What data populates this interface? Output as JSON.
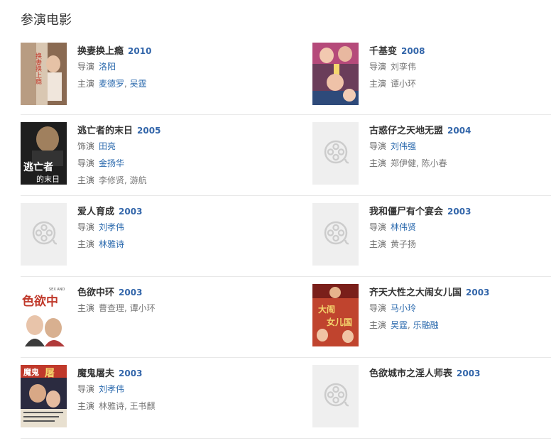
{
  "section_title": "参演电影",
  "colors": {
    "link": "#2a69ad",
    "year": "#3366aa",
    "divider": "#e8e8e8",
    "placeholder": "#efefef"
  },
  "movies": [
    {
      "title": "换妻换上瘾",
      "year": "2010",
      "poster": "poster-1",
      "lines": [
        {
          "label": "导演",
          "people": [
            {
              "name": "洛阳",
              "link": true
            }
          ],
          "text": ""
        },
        {
          "label": "主演",
          "people": [
            {
              "name": "麦德罗",
              "link": true
            },
            {
              "name": "吴霆",
              "link": true
            }
          ],
          "text": ""
        }
      ]
    },
    {
      "title": "千基变",
      "year": "2008",
      "poster": "poster-2",
      "lines": [
        {
          "label": "导演",
          "text": "刘孪伟"
        },
        {
          "label": "主演",
          "text": "谭小环"
        }
      ]
    },
    {
      "title": "逃亡者的末日",
      "year": "2005",
      "poster": "poster-3",
      "lines": [
        {
          "label": "饰演",
          "people": [
            {
              "name": "田亮",
              "link": true
            }
          ],
          "text": ""
        },
        {
          "label": "导演",
          "people": [
            {
              "name": "金扬华",
              "link": true
            }
          ],
          "text": ""
        },
        {
          "label": "主演",
          "text": "李修贤, 游航"
        }
      ]
    },
    {
      "title": "古惑仔之天地无盟",
      "year": "2004",
      "poster": "placeholder",
      "lines": [
        {
          "label": "导演",
          "people": [
            {
              "name": "刘伟强",
              "link": true
            }
          ],
          "text": ""
        },
        {
          "label": "主演",
          "text": "郑伊健, 陈小春"
        }
      ]
    },
    {
      "title": "爱人育成",
      "year": "2003",
      "poster": "placeholder",
      "lines": [
        {
          "label": "导演",
          "people": [
            {
              "name": "刘孝伟",
              "link": true
            }
          ],
          "text": ""
        },
        {
          "label": "主演",
          "people": [
            {
              "name": "林雅诗",
              "link": true
            }
          ],
          "text": ""
        }
      ]
    },
    {
      "title": "我和僵尸有个宴会",
      "year": "2003",
      "poster": "placeholder",
      "lines": [
        {
          "label": "导演",
          "people": [
            {
              "name": "林伟贤",
              "link": true
            }
          ],
          "text": ""
        },
        {
          "label": "主演",
          "text": "黄子扬"
        }
      ]
    },
    {
      "title": "色欲中环",
      "year": "2003",
      "poster": "poster-4",
      "lines": [
        {
          "label": "主演",
          "text": "曹查理, 谭小环"
        }
      ]
    },
    {
      "title": "齐天大性之大闹女儿国",
      "year": "2003",
      "poster": "poster-5",
      "lines": [
        {
          "label": "导演",
          "people": [
            {
              "name": "马小玲",
              "link": true
            }
          ],
          "text": ""
        },
        {
          "label": "主演",
          "people": [
            {
              "name": "吴霆",
              "link": true
            },
            {
              "name": "乐融融",
              "link": true
            }
          ],
          "text": ""
        }
      ]
    },
    {
      "title": "魔鬼屠夫",
      "year": "2003",
      "poster": "poster-6",
      "lines": [
        {
          "label": "导演",
          "people": [
            {
              "name": "刘孝伟",
              "link": true
            }
          ],
          "text": ""
        },
        {
          "label": "主演",
          "text": "林雅诗, 王书麒"
        }
      ]
    },
    {
      "title": "色欲城市之淫人师表",
      "year": "2003",
      "poster": "placeholder",
      "lines": []
    }
  ],
  "poster_text": {
    "poster-1": "换妻换上瘾",
    "poster-3": "逃亡者的末日",
    "poster-4": "色欲中环",
    "poster-4-sub": "SEX AND",
    "poster-5": "大闹女儿国",
    "poster-6": "魔鬼屠夫"
  }
}
